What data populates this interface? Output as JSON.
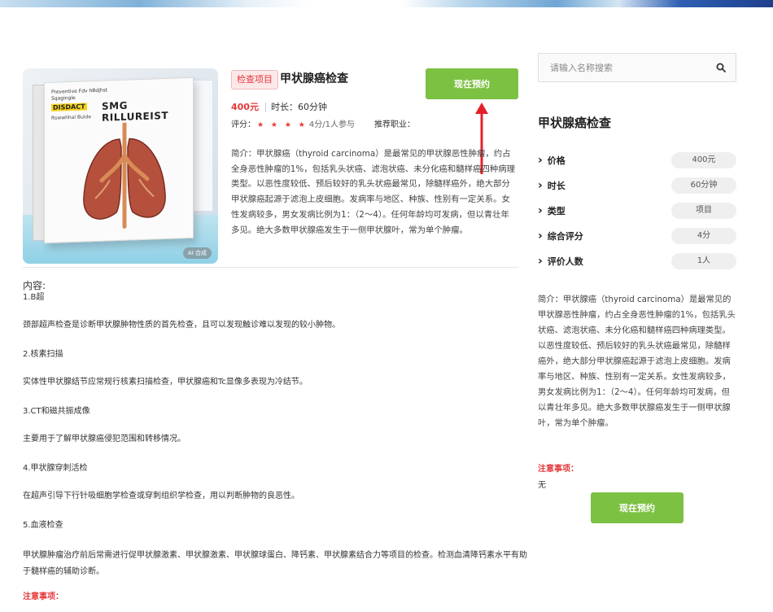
{
  "product": {
    "tag": "检查项目",
    "title": "甲状腺癌检查",
    "book_label": "现在预约",
    "price": "400元",
    "duration": "时长：60分钟",
    "rating_label": "评分：",
    "stars": "★ ★ ★ ★",
    "rating_text": "4分/1人参与",
    "job_label": "推荐职业：",
    "intro": "简介：甲状腺癌（thyroid carcinoma）是最常见的甲状腺恶性肿瘤，约占全身恶性肿瘤的1%，包括乳头状癌、滤泡状癌、未分化癌和髓样癌四种病理类型。以恶性度较低、预后较好的乳头状癌最常见，除髓样癌外，绝大部分甲状腺癌起源于滤泡上皮细胞。发病率与地区、种族、性别有一定关系。女性发病较多，男女发病比例为1：（2～4）。任何年龄均可发病，但以青壮年多见。绝大多数甲状腺癌发生于一侧甲状腺叶，常为单个肿瘤。"
  },
  "image": {
    "box_text_small": "Preventive Fdv hBdjhst Sqagingle",
    "box_text_highlight": "DISDACT",
    "box_text_sub": "Rswwhhal Buide",
    "box_headline": "SMG RILLUREIST",
    "badge": "AI 合成"
  },
  "content": {
    "heading": "内容:",
    "items": [
      {
        "title": "1.B超",
        "desc": "颈部超声检查是诊断甲状腺肿物性质的首先检查，且可以发现触诊难以发现的较小肿物。"
      },
      {
        "title": "2.核素扫描",
        "desc": "实体性甲状腺结节应常规行核素扫描检查，甲状腺癌和Tc显像多表现为冷结节。"
      },
      {
        "title": "3.CT和磁共振成像",
        "desc": "主要用于了解甲状腺癌侵犯范围和转移情况。"
      },
      {
        "title": "4.甲状腺穿刺活检",
        "desc": "在超声引导下行针吸细胞学检查或穿刺组织学检查，用以判断肿物的良恶性。"
      },
      {
        "title": "5.血液检查",
        "desc": "甲状腺肿瘤治疗前后常需进行促甲状腺激素、甲状腺激素、甲状腺球蛋白、降钙素、甲状腺素结合力等项目的检查。检测血清降钙素水平有助于髓样癌的辅助诊断。"
      }
    ],
    "notice_label": "注意事项："
  },
  "sidebar": {
    "search_placeholder": "请输入名称搜索",
    "title": "甲状腺癌检查",
    "attrs": [
      {
        "label": "价格",
        "value": "400元"
      },
      {
        "label": "时长",
        "value": "60分钟"
      },
      {
        "label": "类型",
        "value": "项目"
      },
      {
        "label": "综合评分",
        "value": "4分"
      },
      {
        "label": "评价人数",
        "value": "1人"
      }
    ],
    "intro": "简介：甲状腺癌（thyroid carcinoma）是最常见的甲状腺恶性肿瘤，约占全身恶性肿瘤的1%，包括乳头状癌、滤泡状癌、未分化癌和髓样癌四种病理类型。以恶性度较低、预后较好的乳头状癌最常见，除髓样癌外，绝大部分甲状腺癌起源于滤泡上皮细胞。发病率与地区、种族、性别有一定关系。女性发病较多，男女发病比例为1：（2～4）。任何年龄均可发病，但以青壮年多见。绝大多数甲状腺癌发生于一侧甲状腺叶，常为单个肿瘤。",
    "notice_label": "注意事项：",
    "notice_value": "无",
    "book_label": "现在预约"
  },
  "colors": {
    "accent_green": "#7dc142",
    "accent_red": "#e4393c"
  }
}
